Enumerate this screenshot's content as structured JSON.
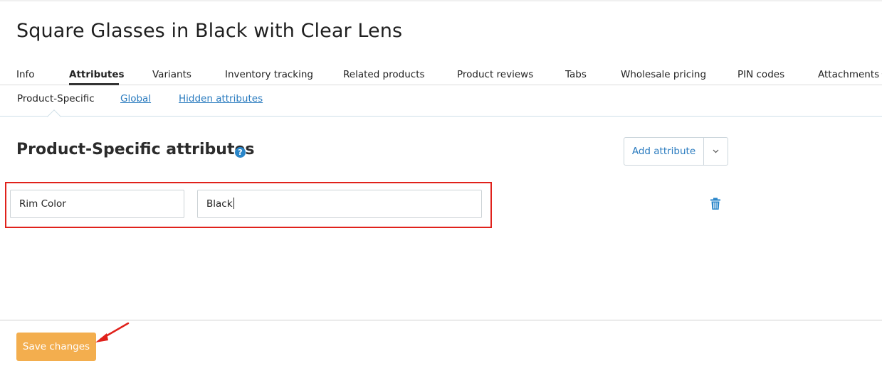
{
  "product": {
    "title": "Square Glasses in Black with Clear Lens"
  },
  "tabs": [
    {
      "label": "Info"
    },
    {
      "label": "Attributes",
      "active": true
    },
    {
      "label": "Variants"
    },
    {
      "label": "Inventory tracking"
    },
    {
      "label": "Related products"
    },
    {
      "label": "Product reviews"
    },
    {
      "label": "Tabs"
    },
    {
      "label": "Wholesale pricing"
    },
    {
      "label": "PIN codes"
    },
    {
      "label": "Attachments"
    }
  ],
  "subtabs": [
    {
      "label": "Product-Specific",
      "active": true
    },
    {
      "label": "Global"
    },
    {
      "label": "Hidden attributes"
    }
  ],
  "section": {
    "title": "Product-Specific attributes",
    "help_icon": "?"
  },
  "add_attribute": {
    "label": "Add attribute",
    "caret_icon": "chevron-down-icon"
  },
  "attribute_row": {
    "name": "Rim Color",
    "value": "Black",
    "delete_icon": "trash-icon"
  },
  "footer": {
    "save_label": "Save changes"
  },
  "colors": {
    "accent": "#2a7bbf",
    "save_button": "#f3ae4e",
    "highlight": "#e0211b"
  }
}
